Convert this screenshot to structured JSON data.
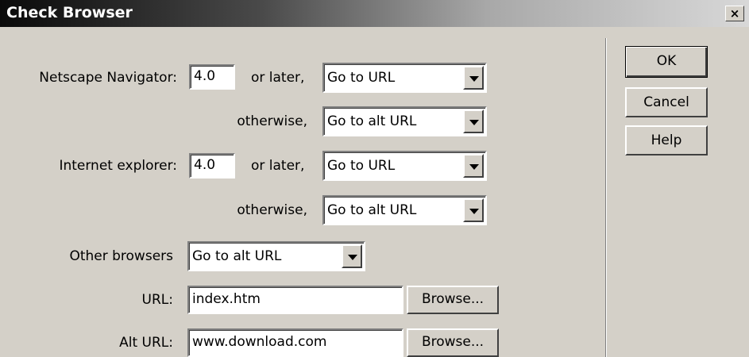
{
  "window": {
    "title": "Check Browser",
    "close_label": "×"
  },
  "netscape": {
    "label": "Netscape Navigator:",
    "version": "4.0",
    "or_later": "or later,",
    "action": "Go to URL",
    "otherwise": "otherwise,",
    "otherwise_action": "Go to alt URL"
  },
  "ie": {
    "label": "Internet explorer:",
    "version": "4.0",
    "or_later": "or later,",
    "action": "Go to URL",
    "otherwise": "otherwise,",
    "otherwise_action": "Go to alt URL"
  },
  "other": {
    "label": "Other browsers",
    "action": "Go to alt URL"
  },
  "url": {
    "label": "URL:",
    "value": "index.htm",
    "browse": "Browse..."
  },
  "alt_url": {
    "label": "Alt URL:",
    "value": "www.download.com",
    "browse": "Browse..."
  },
  "buttons": {
    "ok": "OK",
    "cancel": "Cancel",
    "help": "Help"
  }
}
